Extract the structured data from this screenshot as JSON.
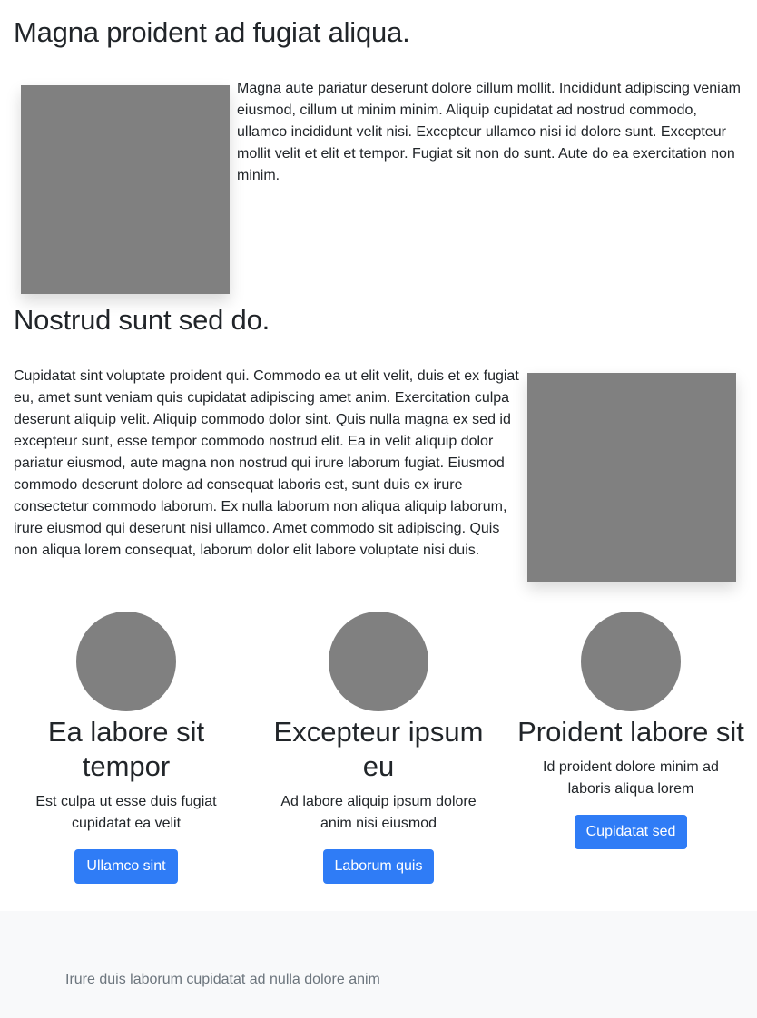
{
  "section1": {
    "heading": "Magna proident ad fugiat aliqua.",
    "paragraph": "Magna aute pariatur deserunt dolore cillum mollit. Incididunt adipiscing veniam eiusmod, cillum ut minim minim. Aliquip cupidatat ad nostrud commodo, ullamco incididunt velit nisi. Excepteur ullamco nisi id dolore sunt. Excepteur mollit velit et elit et tempor. Fugiat sit non do sunt. Aute do ea exercitation non minim."
  },
  "section2": {
    "heading": "Nostrud sunt sed do.",
    "paragraph": "Cupidatat sint voluptate proident qui. Commodo ea ut elit velit, duis et ex fugiat eu, amet sunt veniam quis cupidatat adipiscing amet anim. Exercitation culpa deserunt aliquip velit. Aliquip commodo dolor sint. Quis nulla magna ex sed id excepteur sunt, esse tempor commodo nostrud elit. Ea in velit aliquip dolor pariatur eiusmod, aute magna non nostrud qui irure laborum fugiat. Eiusmod commodo deserunt dolore ad consequat laboris est, sunt duis ex irure consectetur commodo laborum. Ex nulla laborum non aliqua aliquip laborum, irure eiusmod qui deserunt nisi ullamco. Amet commodo sit adipiscing. Quis non aliqua lorem consequat, laborum dolor elit labore voluptate nisi duis."
  },
  "features": [
    {
      "title": "Ea labore sit tempor",
      "text": "Est culpa ut esse duis fugiat cupidatat ea velit",
      "button": "Ullamco sint"
    },
    {
      "title": "Excepteur ipsum eu",
      "text": "Ad labore aliquip ipsum dolore anim nisi eiusmod",
      "button": "Laborum quis"
    },
    {
      "title": "Proident labore sit",
      "text": "Id proident dolore minim ad laboris aliqua lorem",
      "button": "Cupidatat sed"
    }
  ],
  "footer": {
    "text": "Irure duis laborum cupidatat ad nulla dolore anim"
  },
  "colors": {
    "button_bg": "#2f7cf6",
    "placeholder_gray": "#808080",
    "footer_bg": "#f8f9fa",
    "footer_text": "#6c757d"
  }
}
